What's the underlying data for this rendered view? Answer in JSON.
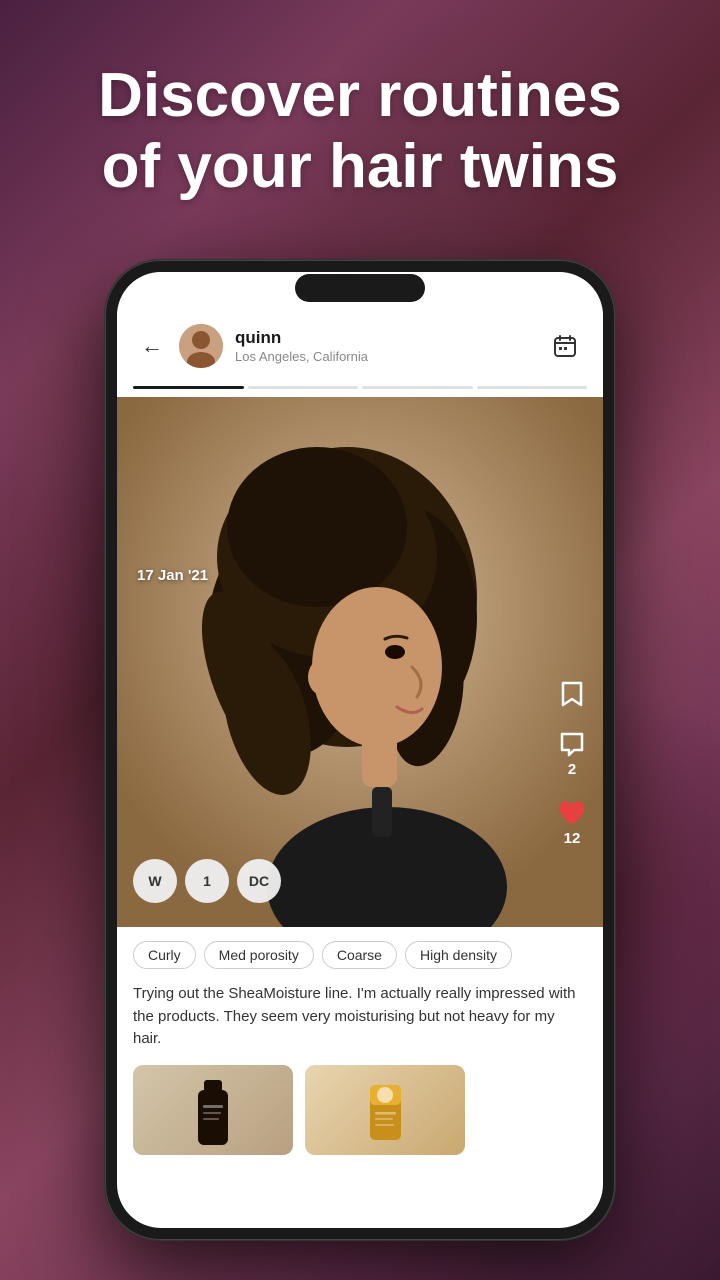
{
  "headline": {
    "line1": "Discover routines",
    "line2": "of your hair twins"
  },
  "header": {
    "back_label": "←",
    "user": {
      "name": "quinn",
      "location": "Los Angeles, California"
    },
    "calendar_icon": "calendar-icon"
  },
  "progress": {
    "bars": [
      {
        "active": true
      },
      {
        "active": false
      },
      {
        "active": false
      },
      {
        "active": false
      }
    ]
  },
  "post": {
    "date": "17 Jan '21",
    "badges": [
      "W",
      "1",
      "DC"
    ],
    "icons": {
      "bookmark_icon": "bookmark-icon",
      "comment_icon": "comment-icon",
      "comment_count": "2",
      "heart_icon": "heart-icon",
      "heart_count": "12"
    },
    "tags": [
      "Curly",
      "Med porosity",
      "Coarse",
      "High density"
    ],
    "text": "Trying out the SheaMoisture line. I'm actually really impressed with the products. They seem very moisturising but not heavy for my hair."
  },
  "products": [
    {
      "label": "product-1"
    },
    {
      "label": "product-2"
    }
  ]
}
